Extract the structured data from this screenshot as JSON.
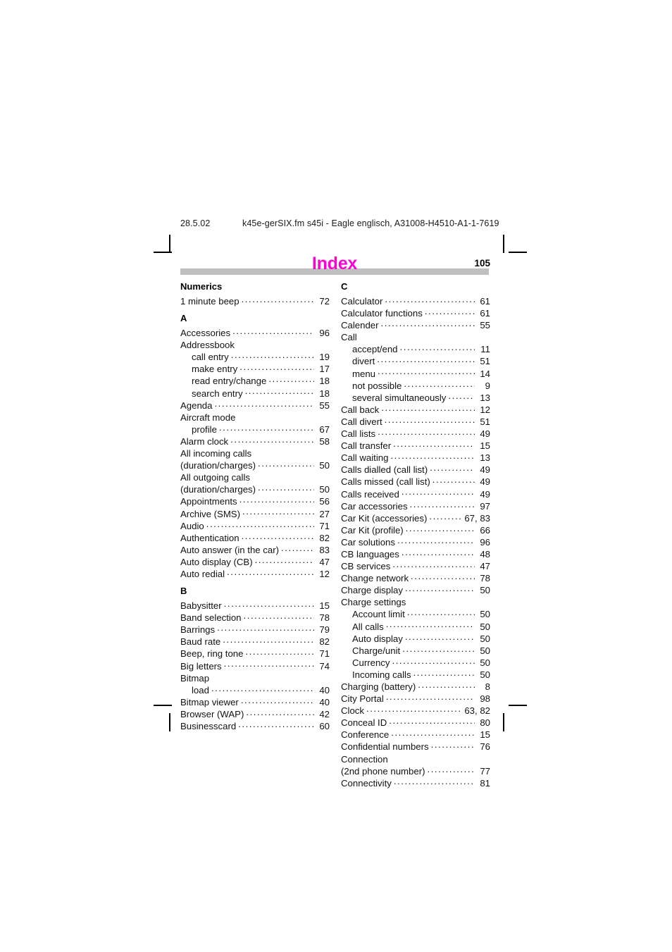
{
  "document": {
    "header": {
      "date": "28.5.02",
      "file_info": "k45e-gerSIX.fm  s45i - Eagle englisch, A31008-H4510-A1-1-7619"
    },
    "title": "Index",
    "page_number": "105",
    "title_color": "#ff00d4",
    "band_color": "#bfbfbf"
  },
  "columns": [
    {
      "id": "left",
      "sections": [
        {
          "letter": "Numerics",
          "entries": [
            {
              "label": "1 minute beep",
              "page": "72",
              "sub": false,
              "leader": true
            }
          ]
        },
        {
          "letter": "A",
          "entries": [
            {
              "label": "Accessories",
              "page": "96",
              "sub": false,
              "leader": true
            },
            {
              "label": "Addressbook",
              "page": "",
              "sub": false,
              "leader": false
            },
            {
              "label": "call entry",
              "page": "19",
              "sub": true,
              "leader": true
            },
            {
              "label": "make entry",
              "page": "17",
              "sub": true,
              "leader": true
            },
            {
              "label": "read entry/change",
              "page": "18",
              "sub": true,
              "leader": true
            },
            {
              "label": "search entry",
              "page": "18",
              "sub": true,
              "leader": true
            },
            {
              "label": "Agenda",
              "page": "55",
              "sub": false,
              "leader": true
            },
            {
              "label": "Aircraft mode",
              "page": "",
              "sub": false,
              "leader": false
            },
            {
              "label": "profile",
              "page": "67",
              "sub": true,
              "leader": true
            },
            {
              "label": "Alarm clock",
              "page": "58",
              "sub": false,
              "leader": true
            },
            {
              "label": "All incoming calls",
              "page": "",
              "sub": false,
              "leader": false
            },
            {
              "label": "(duration/charges)",
              "page": "50",
              "sub": false,
              "leader": true
            },
            {
              "label": "All outgoing calls",
              "page": "",
              "sub": false,
              "leader": false
            },
            {
              "label": "(duration/charges)",
              "page": "50",
              "sub": false,
              "leader": true
            },
            {
              "label": "Appointments",
              "page": "56",
              "sub": false,
              "leader": true
            },
            {
              "label": "Archive (SMS)",
              "page": "27",
              "sub": false,
              "leader": true
            },
            {
              "label": "Audio",
              "page": "71",
              "sub": false,
              "leader": true
            },
            {
              "label": "Authentication",
              "page": "82",
              "sub": false,
              "leader": true
            },
            {
              "label": "Auto answer (in the car)",
              "page": "83",
              "sub": false,
              "leader": true
            },
            {
              "label": "Auto display (CB)",
              "page": "47",
              "sub": false,
              "leader": true
            },
            {
              "label": "Auto redial",
              "page": "12",
              "sub": false,
              "leader": true
            }
          ]
        },
        {
          "letter": "B",
          "entries": [
            {
              "label": "Babysitter",
              "page": "15",
              "sub": false,
              "leader": true
            },
            {
              "label": "Band selection",
              "page": "78",
              "sub": false,
              "leader": true
            },
            {
              "label": "Barrings",
              "page": "79",
              "sub": false,
              "leader": true
            },
            {
              "label": "Baud rate",
              "page": "82",
              "sub": false,
              "leader": true
            },
            {
              "label": "Beep, ring tone",
              "page": "71",
              "sub": false,
              "leader": true
            },
            {
              "label": "Big letters",
              "page": "74",
              "sub": false,
              "leader": true
            },
            {
              "label": "Bitmap",
              "page": "",
              "sub": false,
              "leader": false
            },
            {
              "label": "load",
              "page": "40",
              "sub": true,
              "leader": true
            },
            {
              "label": "Bitmap viewer",
              "page": "40",
              "sub": false,
              "leader": true
            },
            {
              "label": "Browser (WAP)",
              "page": "42",
              "sub": false,
              "leader": true
            },
            {
              "label": "Businesscard",
              "page": "60",
              "sub": false,
              "leader": true
            }
          ]
        }
      ]
    },
    {
      "id": "right",
      "sections": [
        {
          "letter": "C",
          "entries": [
            {
              "label": "Calculator",
              "page": "61",
              "sub": false,
              "leader": true
            },
            {
              "label": "Calculator functions",
              "page": "61",
              "sub": false,
              "leader": true
            },
            {
              "label": "Calender",
              "page": "55",
              "sub": false,
              "leader": true
            },
            {
              "label": "Call",
              "page": "",
              "sub": false,
              "leader": false
            },
            {
              "label": "accept/end",
              "page": "11",
              "sub": true,
              "leader": true
            },
            {
              "label": "divert",
              "page": "51",
              "sub": true,
              "leader": true
            },
            {
              "label": "menu",
              "page": "14",
              "sub": true,
              "leader": true
            },
            {
              "label": "not possible",
              "page": "9",
              "sub": true,
              "leader": true
            },
            {
              "label": "several simultaneously",
              "page": "13",
              "sub": true,
              "leader": true
            },
            {
              "label": "Call back",
              "page": "12",
              "sub": false,
              "leader": true
            },
            {
              "label": "Call divert",
              "page": "51",
              "sub": false,
              "leader": true
            },
            {
              "label": "Call lists",
              "page": "49",
              "sub": false,
              "leader": true
            },
            {
              "label": "Call transfer",
              "page": "15",
              "sub": false,
              "leader": true
            },
            {
              "label": "Call waiting",
              "page": "13",
              "sub": false,
              "leader": true
            },
            {
              "label": "Calls dialled (call list)",
              "page": "49",
              "sub": false,
              "leader": true
            },
            {
              "label": "Calls missed (call list)",
              "page": "49",
              "sub": false,
              "leader": true
            },
            {
              "label": "Calls received",
              "page": "49",
              "sub": false,
              "leader": true
            },
            {
              "label": "Car accessories",
              "page": "97",
              "sub": false,
              "leader": true
            },
            {
              "label": "Car Kit (accessories)",
              "page": "67, 83",
              "sub": false,
              "leader": true
            },
            {
              "label": "Car Kit (profile)",
              "page": "66",
              "sub": false,
              "leader": true
            },
            {
              "label": "Car solutions",
              "page": "96",
              "sub": false,
              "leader": true
            },
            {
              "label": "CB languages",
              "page": "48",
              "sub": false,
              "leader": true
            },
            {
              "label": "CB services",
              "page": "47",
              "sub": false,
              "leader": true
            },
            {
              "label": "Change network",
              "page": "78",
              "sub": false,
              "leader": true
            },
            {
              "label": "Charge display",
              "page": "50",
              "sub": false,
              "leader": true
            },
            {
              "label": "Charge settings",
              "page": "",
              "sub": false,
              "leader": false
            },
            {
              "label": "Account limit",
              "page": "50",
              "sub": true,
              "leader": true
            },
            {
              "label": "All calls",
              "page": "50",
              "sub": true,
              "leader": true
            },
            {
              "label": "Auto display",
              "page": "50",
              "sub": true,
              "leader": true
            },
            {
              "label": "Charge/unit",
              "page": "50",
              "sub": true,
              "leader": true
            },
            {
              "label": "Currency",
              "page": "50",
              "sub": true,
              "leader": true
            },
            {
              "label": "Incoming calls",
              "page": "50",
              "sub": true,
              "leader": true
            },
            {
              "label": "Charging (battery)",
              "page": "8",
              "sub": false,
              "leader": true
            },
            {
              "label": "City Portal",
              "page": "98",
              "sub": false,
              "leader": true
            },
            {
              "label": "Clock",
              "page": "63, 82",
              "sub": false,
              "leader": true
            },
            {
              "label": "Conceal ID",
              "page": "80",
              "sub": false,
              "leader": true
            },
            {
              "label": "Conference",
              "page": "15",
              "sub": false,
              "leader": true
            },
            {
              "label": "Confidential numbers",
              "page": "76",
              "sub": false,
              "leader": true
            },
            {
              "label": "Connection",
              "page": "",
              "sub": false,
              "leader": false
            },
            {
              "label": "(2nd phone number)",
              "page": "77",
              "sub": false,
              "leader": true
            },
            {
              "label": "Connectivity",
              "page": "81",
              "sub": false,
              "leader": true
            }
          ]
        }
      ]
    }
  ]
}
